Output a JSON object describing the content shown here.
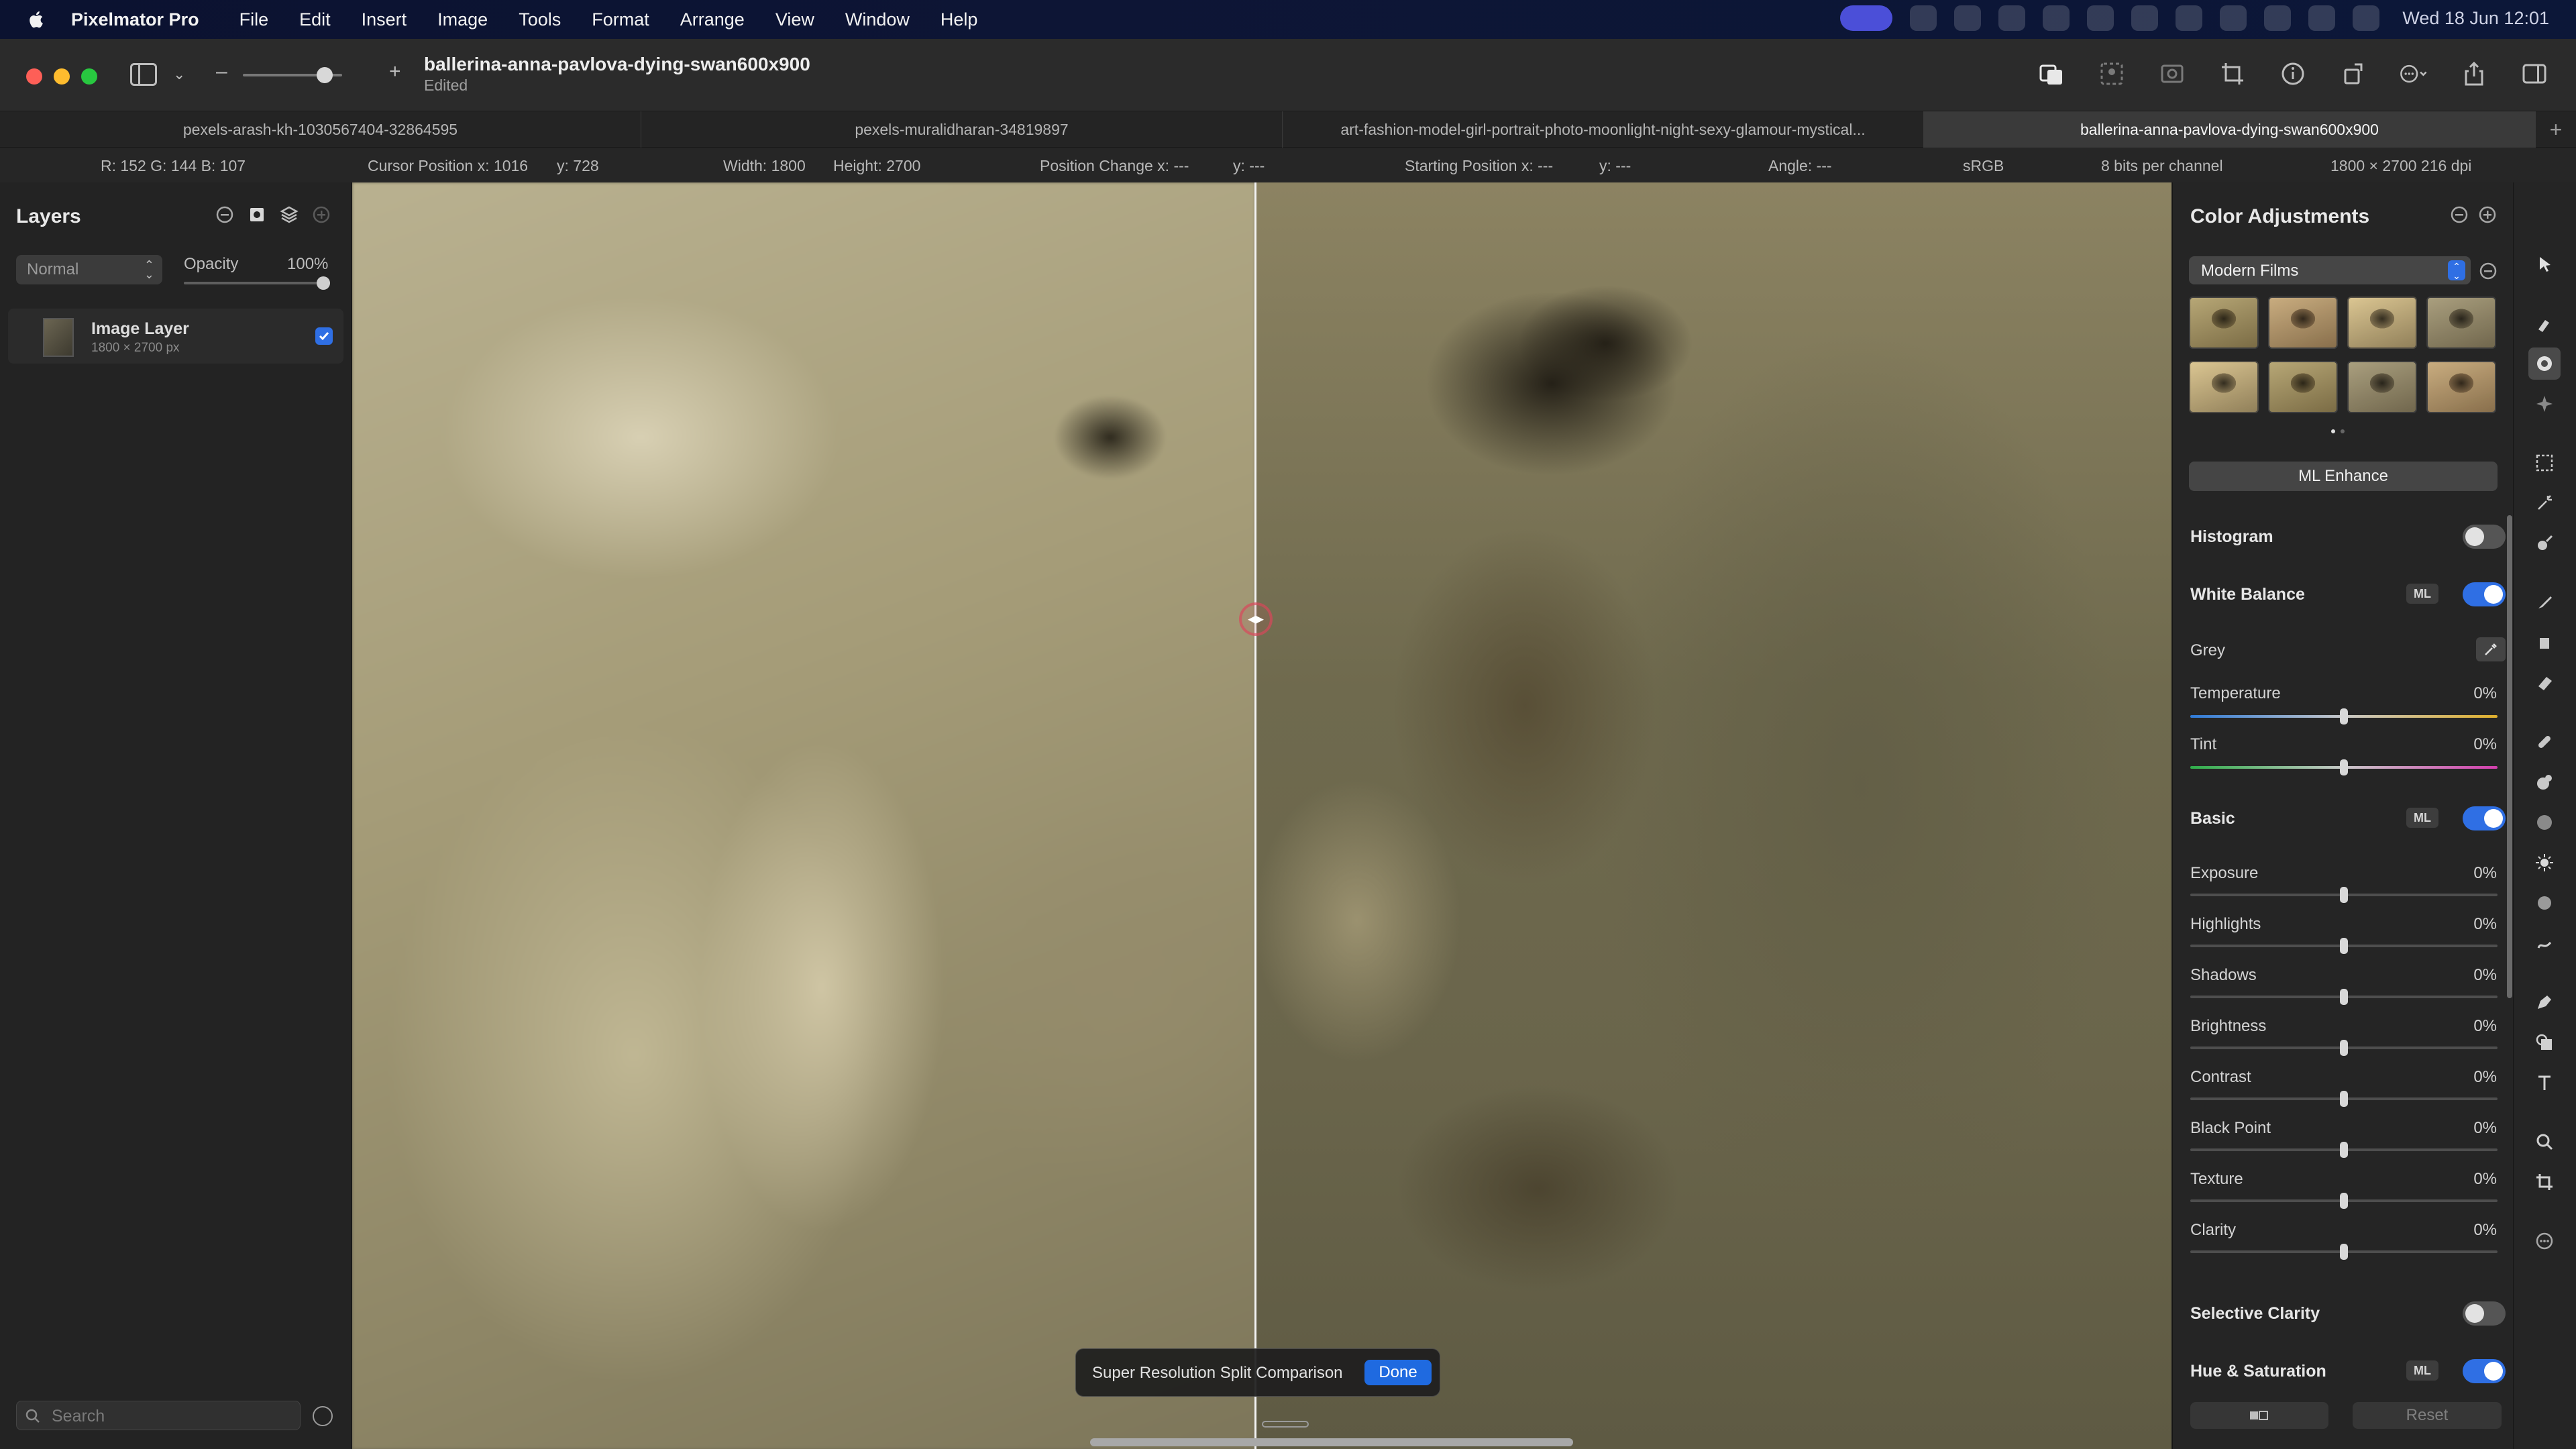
{
  "menubar": {
    "app_name": "Pixelmator Pro",
    "items": [
      "File",
      "Edit",
      "Insert",
      "Image",
      "Tools",
      "Format",
      "Arrange",
      "View",
      "Window",
      "Help"
    ],
    "clock": "Wed 18 Jun 12:01"
  },
  "titlebar": {
    "document_title": "ballerina-anna-pavlova-dying-swan600x900",
    "document_status": "Edited"
  },
  "tabs": [
    {
      "label": "pexels-arash-kh-1030567404-32864595",
      "active": false
    },
    {
      "label": "pexels-muralidharan-34819897",
      "active": false
    },
    {
      "label": "art-fashion-model-girl-portrait-photo-moonlight-night-sexy-glamour-mystical...",
      "active": false
    },
    {
      "label": "ballerina-anna-pavlova-dying-swan600x900",
      "active": true
    }
  ],
  "infobar": {
    "rgb": "R: 152   G: 144   B: 107",
    "cursor_x": "Cursor Position x: 1016",
    "cursor_y": "y: 728",
    "width": "Width: 1800",
    "height": "Height: 2700",
    "pos_change_x": "Position Change x: ---",
    "pos_change_y": "y: ---",
    "start_x": "Starting Position x: ---",
    "start_y": "y: ---",
    "angle": "Angle: ---",
    "colorspace": "sRGB",
    "bits": "8 bits per channel",
    "dimensions": "1800 × 2700 216 dpi"
  },
  "layers": {
    "title": "Layers",
    "blend_mode": "Normal",
    "opacity_label": "Opacity",
    "opacity_value": "100%",
    "opacity_fraction": 1.0,
    "layer_name": "Image Layer",
    "layer_size": "1800 × 2700 px",
    "search_placeholder": "Search"
  },
  "canvas": {
    "split_fraction": 0.497,
    "hud_label": "Super Resolution Split Comparison",
    "hud_done": "Done"
  },
  "adjustments": {
    "title": "Color Adjustments",
    "preset": "Modern Films",
    "ml_enhance": "ML Enhance",
    "ml_badge": "ML",
    "histogram": "Histogram",
    "white_balance": "White Balance",
    "grey": "Grey",
    "temperature_label": "Temperature",
    "temperature_value": "0%",
    "tint_label": "Tint",
    "tint_value": "0%",
    "basic": "Basic",
    "basic_rows": [
      {
        "label": "Exposure",
        "value": "0%"
      },
      {
        "label": "Highlights",
        "value": "0%"
      },
      {
        "label": "Shadows",
        "value": "0%"
      },
      {
        "label": "Brightness",
        "value": "0%"
      },
      {
        "label": "Contrast",
        "value": "0%"
      },
      {
        "label": "Black Point",
        "value": "0%"
      },
      {
        "label": "Texture",
        "value": "0%"
      },
      {
        "label": "Clarity",
        "value": "0%"
      }
    ],
    "selective_clarity": "Selective Clarity",
    "hue_saturation": "Hue & Saturation",
    "reset": "Reset"
  },
  "colors": {
    "accent": "#2f6fe4",
    "close": "#fe5f57",
    "minimize": "#febc2e",
    "zoom": "#28c840"
  }
}
